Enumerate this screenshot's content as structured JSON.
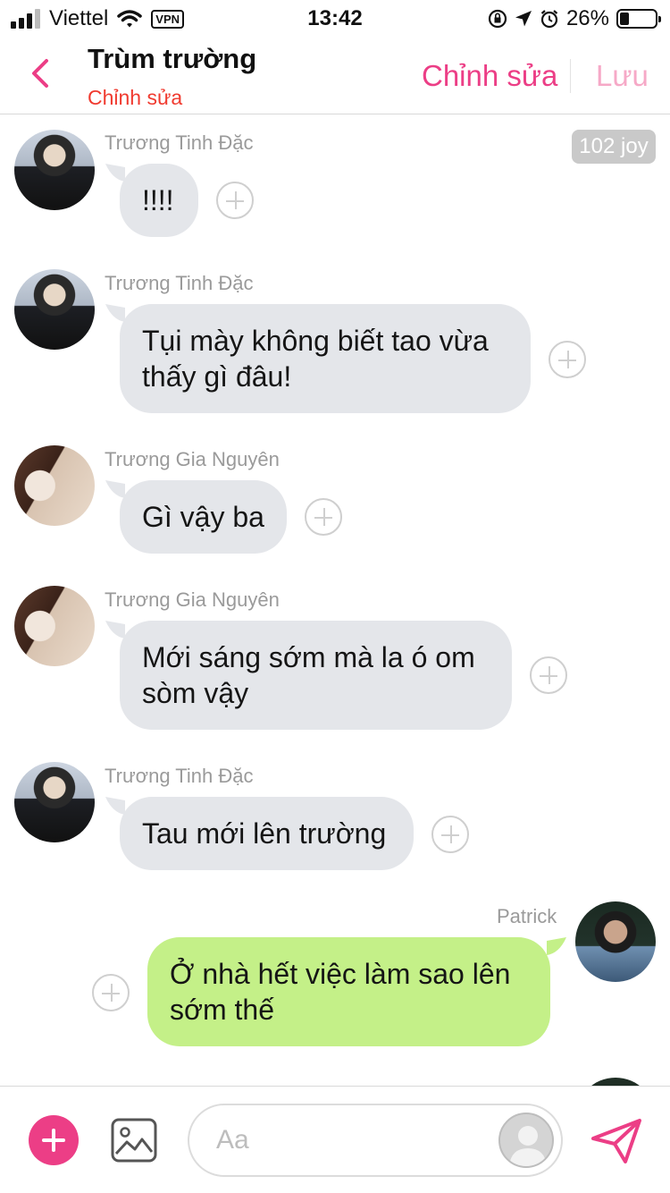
{
  "status_bar": {
    "carrier": "Viettel",
    "vpn": "VPN",
    "time": "13:42",
    "battery": "26%",
    "battery_level": 0.26
  },
  "header": {
    "title": "Trùm trường",
    "subtitle": "Chỉnh sửa",
    "edit_label": "Chỉnh sửa",
    "save_label": "Lưu"
  },
  "joy_badge": "102 joy",
  "messages": [
    {
      "sender": "Trương Tinh Đặc",
      "lines": [
        "!!!!"
      ]
    },
    {
      "sender": "Trương Tinh Đặc",
      "lines": [
        "Tụi mày không biết tao vừa",
        "thấy gì đâu!"
      ]
    },
    {
      "sender": "Trương Gia Nguyên",
      "lines": [
        "Gì vậy ba"
      ]
    },
    {
      "sender": "Trương Gia Nguyên",
      "lines": [
        "Mới sáng sớm mà la ó om",
        "sòm vậy"
      ]
    },
    {
      "sender": "Trương Tinh Đặc",
      "lines": [
        "Tau mới lên trường"
      ]
    },
    {
      "sender": "Patrick",
      "lines": [
        "Ở nhà hết việc làm sao lên",
        "sớm thế"
      ]
    }
  ],
  "composer": {
    "placeholder": "Aa"
  },
  "colors": {
    "accent": "#ec3e86",
    "subtitle": "#f03a2f",
    "incoming_bubble": "#e4e6ea",
    "outgoing_bubble": "#c4f088"
  }
}
